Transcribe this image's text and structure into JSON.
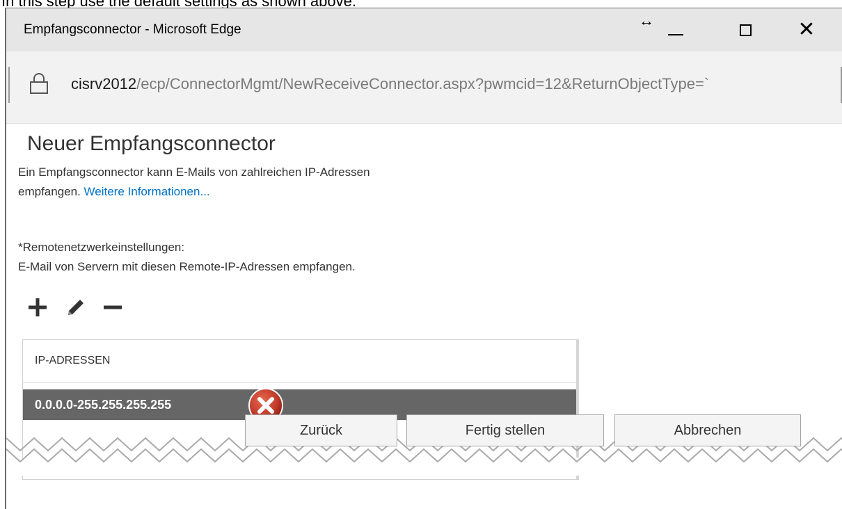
{
  "caption": "In this step use the default settings as shown above.",
  "window": {
    "title": "Empfangsconnector - Microsoft Edge",
    "resize_icon": "↔",
    "controls": {
      "minimize": "minimize-icon",
      "maximize": "maximize-icon",
      "close": "close-icon"
    }
  },
  "address": {
    "host": "cisrv2012",
    "path": "/ecp/ConnectorMgmt/NewReceiveConnector.aspx?pwmcid=12&ReturnObjectType=`"
  },
  "page": {
    "title": "Neuer Empfangsconnector",
    "description_line1": "Ein Empfangsconnector kann E-Mails von zahlreichen IP-Adressen",
    "description_line2": "empfangen.",
    "more_info_link": "Weitere Informationen...",
    "remote_label": "*Remotenetzwerkeinstellungen:",
    "remote_desc": "E-Mail von Servern mit diesen Remote-IP-Adressen empfangen."
  },
  "toolbar": {
    "add": "plus-icon",
    "edit": "pencil-icon",
    "remove": "minus-icon"
  },
  "ip_list": {
    "header": "IP-ADRESSEN",
    "rows": [
      "0.0.0.0-255.255.255.255"
    ],
    "marker": "error-x-icon"
  },
  "buttons": {
    "back": "Zurück",
    "finish": "Fertig stellen",
    "cancel": "Abbrechen"
  },
  "colors": {
    "titlebar": "#e6e6e6",
    "selected_row": "#666666",
    "link": "#0072c6",
    "error_badge": "#c0392b"
  }
}
